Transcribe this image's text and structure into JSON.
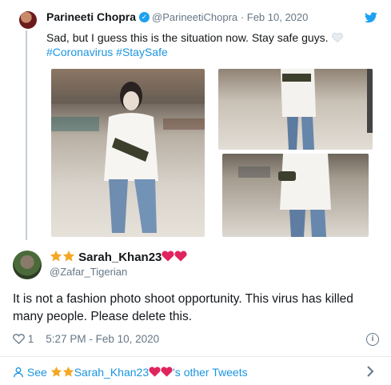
{
  "quoted_tweet": {
    "display_name": "Parineeti Chopra",
    "handle": "@ParineetiChopra",
    "separator": "·",
    "date": "Feb 10, 2020",
    "text": "Sad, but I guess this is the situation now. Stay safe guys.",
    "hashtags": "#Coronavirus #StaySafe",
    "photos": [
      "main-photo",
      "top-right-photo",
      "bottom-right-photo"
    ]
  },
  "reply": {
    "display_name": "Sarah_Khan23",
    "handle": "@Zafar_Tigerian",
    "text": "It is not a fashion photo shoot opportunity. This virus has killed many people. Please delete this.",
    "like_count": "1",
    "timestamp": "5:27 PM - Feb 10, 2020"
  },
  "footer": {
    "see_label": "See",
    "name": "Sarah_Khan23",
    "suffix": "'s other Tweets"
  },
  "colors": {
    "link": "#1b95e0",
    "muted": "#657786",
    "heart_red": "#e0245e",
    "star": "#f5a623",
    "twitter_blue": "#1da1f2"
  },
  "icons": [
    "twitter-bird-icon",
    "verified-badge-icon",
    "heart-icon",
    "info-icon",
    "person-icon",
    "chevron-right-icon",
    "star-emoji",
    "red-heart-emoji",
    "white-heart-emoji"
  ]
}
